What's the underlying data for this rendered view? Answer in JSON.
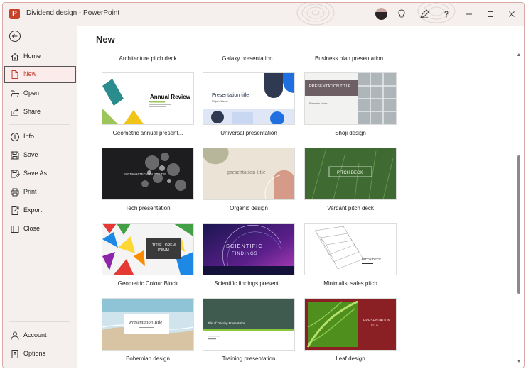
{
  "app": {
    "title": "Dividend design - PowerPoint",
    "logo": "P"
  },
  "sidebar": {
    "items": [
      {
        "label": "Home",
        "icon": "home-icon"
      },
      {
        "label": "New",
        "icon": "new-document-icon",
        "selected": true
      },
      {
        "label": "Open",
        "icon": "folder-open-icon"
      },
      {
        "label": "Share",
        "icon": "share-icon"
      },
      {
        "label": "Info",
        "icon": "info-icon"
      },
      {
        "label": "Save",
        "icon": "save-icon"
      },
      {
        "label": "Save As",
        "icon": "save-as-icon"
      },
      {
        "label": "Print",
        "icon": "print-icon"
      },
      {
        "label": "Export",
        "icon": "export-icon"
      },
      {
        "label": "Close",
        "icon": "close-document-icon"
      },
      {
        "label": "Account",
        "icon": "account-icon"
      },
      {
        "label": "Options",
        "icon": "options-icon"
      }
    ]
  },
  "main": {
    "title": "New",
    "top_labels": [
      "Architecture pitch deck",
      "Galaxy presentation",
      "Business plan presentation"
    ],
    "templates": [
      {
        "label": "Geometric annual present...",
        "thumb_text": "Annual Review"
      },
      {
        "label": "Universal presentation",
        "thumb_text": "Presentation title",
        "thumb_sub": "Mirjam Nilsson"
      },
      {
        "label": "Shoji design",
        "thumb_text": "PRESENTATION TITLE",
        "thumb_sub": "Presenter Name"
      },
      {
        "label": "Tech presentation",
        "thumb_text": "PARTIKAM TECHNOLOGY TIP"
      },
      {
        "label": "Organic design",
        "thumb_text": "presentation title"
      },
      {
        "label": "Verdant pitch deck",
        "thumb_text": "PITCH DECK"
      },
      {
        "label": "Geometric Colour Block",
        "thumb_text": "TITLE LOREM",
        "thumb_text2": "IPSUM"
      },
      {
        "label": "Scientific findings present...",
        "thumb_text": "SCIENTIFIC",
        "thumb_text2": "FINDINGS"
      },
      {
        "label": "Minimalist sales pitch",
        "thumb_text": "PITCH DECK"
      },
      {
        "label": "Bohemian design",
        "thumb_text": "Presentation Title"
      },
      {
        "label": "Training presentation",
        "thumb_text": "Title of Training Presentation"
      },
      {
        "label": "Leaf design",
        "thumb_text": "PRESENTATION",
        "thumb_text2": "TITLE"
      }
    ]
  },
  "colors": {
    "accent": "#c0392b",
    "sidebar_bg": "#f5f0ee",
    "selected_bg": "#fbeceb"
  }
}
